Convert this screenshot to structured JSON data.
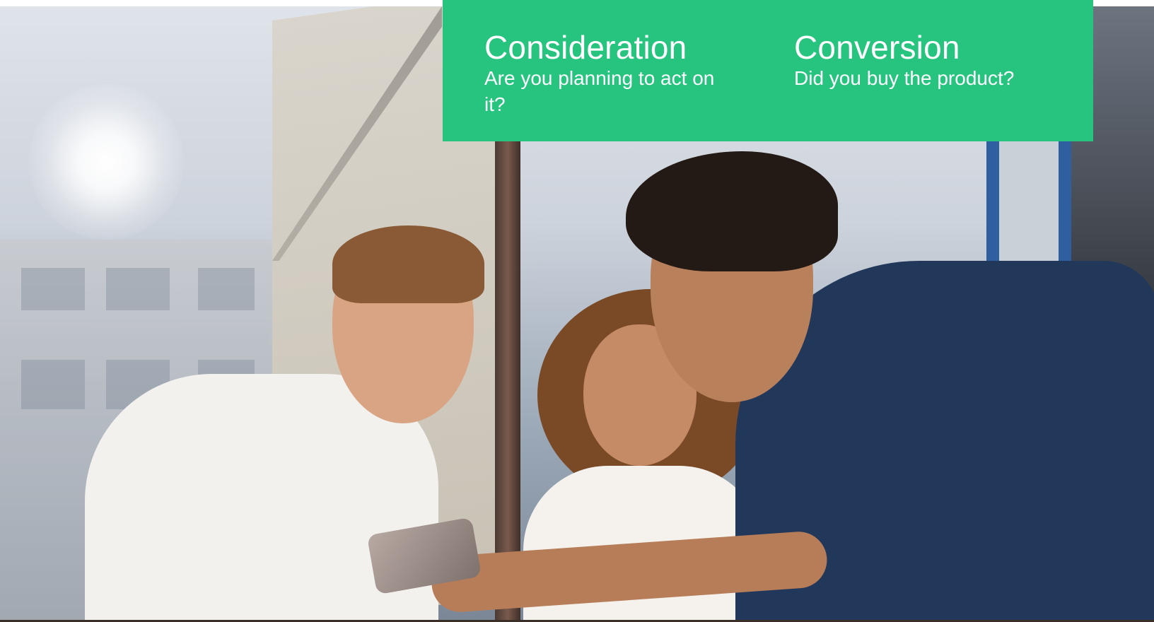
{
  "banner": {
    "background_color": "#26c47f",
    "text_color": "#ffffff",
    "cards": [
      {
        "title": "Consideration",
        "description": "Are you planning to act on it?"
      },
      {
        "title": "Conversion",
        "description": "Did you buy the product?"
      }
    ]
  }
}
